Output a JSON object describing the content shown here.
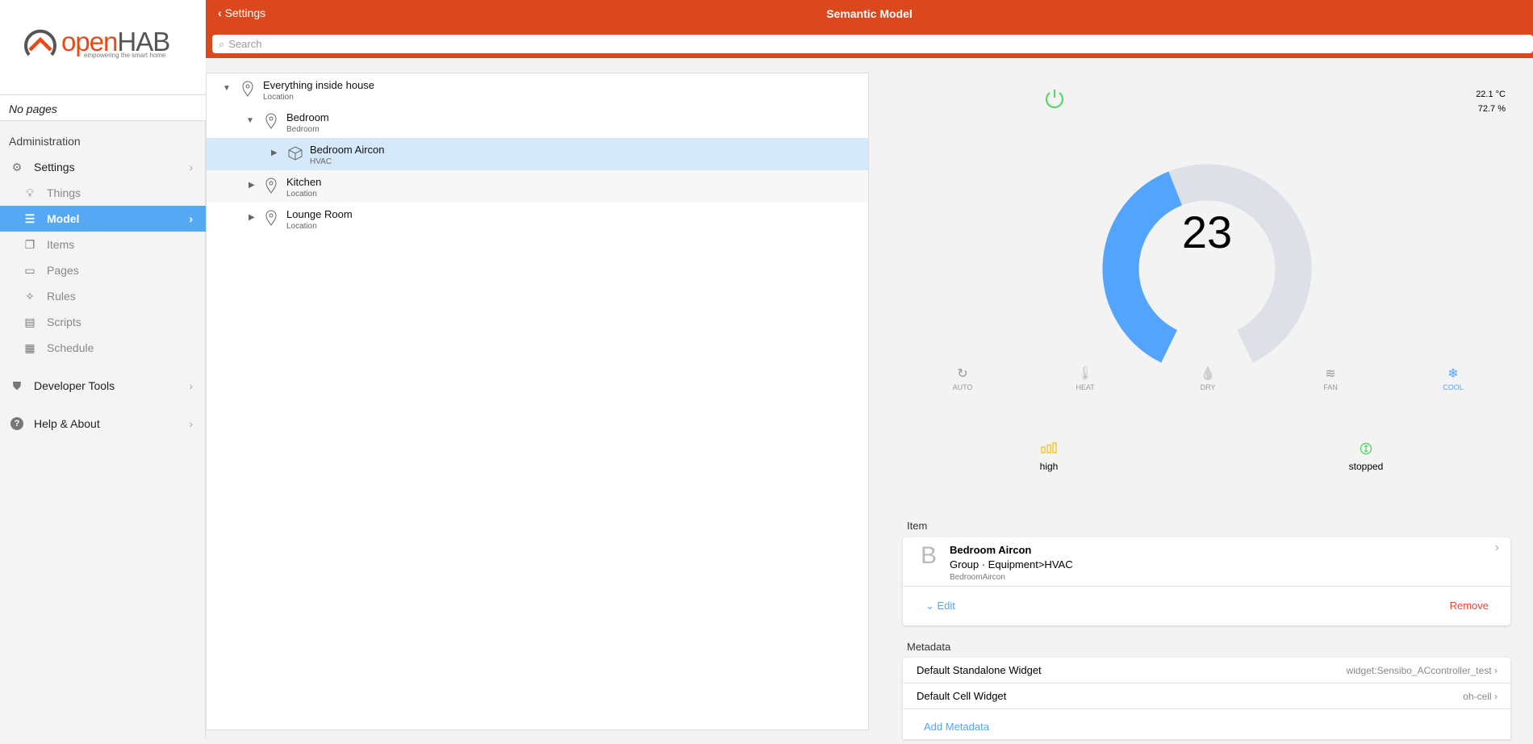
{
  "sidebar": {
    "logo_text": "openHAB",
    "logo_tagline": "empowering the smart home",
    "no_pages": "No pages",
    "section": "Administration",
    "items": [
      {
        "label": "Settings",
        "icon": "gear-icon"
      },
      {
        "label": "Things",
        "icon": "lightbulb-icon"
      },
      {
        "label": "Model",
        "icon": "list-icon"
      },
      {
        "label": "Items",
        "icon": "items-icon"
      },
      {
        "label": "Pages",
        "icon": "monitor-icon"
      },
      {
        "label": "Rules",
        "icon": "wand-icon"
      },
      {
        "label": "Scripts",
        "icon": "script-icon"
      },
      {
        "label": "Schedule",
        "icon": "calendar-icon"
      },
      {
        "label": "Developer Tools",
        "icon": "shield-icon"
      },
      {
        "label": "Help & About",
        "icon": "help-icon"
      }
    ]
  },
  "header": {
    "back": "Settings",
    "title": "Semantic Model",
    "search_placeholder": "Search"
  },
  "tree": [
    {
      "label": "Everything inside house",
      "type": "Location"
    },
    {
      "label": "Bedroom",
      "type": "Bedroom"
    },
    {
      "label": "Bedroom Aircon",
      "type": "HVAC"
    },
    {
      "label": "Kitchen",
      "type": "Location"
    },
    {
      "label": "Lounge Room",
      "type": "Location"
    }
  ],
  "widget": {
    "temperature": "22.1 °C",
    "humidity": "72.7 %",
    "setpoint": "23",
    "setpoint_fraction": 0.43,
    "power_color": "#5bd36a",
    "accent": "#52a4fc",
    "modes": [
      {
        "label": "AUTO",
        "icon": "↻"
      },
      {
        "label": "HEAT",
        "icon": "🌡"
      },
      {
        "label": "DRY",
        "icon": "💧"
      },
      {
        "label": "FAN",
        "icon": "≋"
      },
      {
        "label": "COOL",
        "icon": "❄"
      }
    ],
    "active_mode": "COOL",
    "fan": "high",
    "swing": "stopped"
  },
  "item": {
    "header": "Item",
    "initial": "B",
    "name": "Bedroom Aircon",
    "type": "Group · Equipment>HVAC",
    "id": "BedroomAircon",
    "edit": "Edit",
    "remove": "Remove"
  },
  "metadata": {
    "header": "Metadata",
    "rows": [
      {
        "label": "Default Standalone Widget",
        "value": "widget:Sensibo_ACcontroller_test"
      },
      {
        "label": "Default Cell Widget",
        "value": "oh-cell"
      }
    ],
    "add": "Add Metadata"
  }
}
